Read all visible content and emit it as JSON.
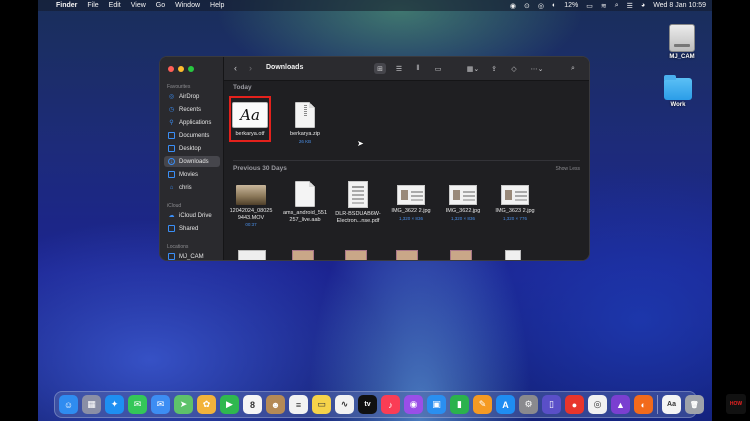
{
  "menubar": {
    "app_name": "Finder",
    "items": [
      "File",
      "Edit",
      "View",
      "Go",
      "Window",
      "Help"
    ],
    "battery": "12%",
    "clock": "Wed 8 Jan  10:59"
  },
  "desktop": {
    "icons": [
      {
        "label": "MJ_CAM",
        "icon": "external-drive-icon"
      },
      {
        "label": "Work",
        "icon": "folder-icon"
      }
    ]
  },
  "finder": {
    "title": "Downloads",
    "sidebar": {
      "favourites_header": "Favourites",
      "favourites": [
        {
          "label": "AirDrop",
          "icon": "airdrop-icon"
        },
        {
          "label": "Recents",
          "icon": "clock-icon"
        },
        {
          "label": "Applications",
          "icon": "applications-icon"
        },
        {
          "label": "Documents",
          "icon": "document-icon"
        },
        {
          "label": "Desktop",
          "icon": "desktop-icon"
        },
        {
          "label": "Downloads",
          "icon": "downloads-icon",
          "active": true
        },
        {
          "label": "Movies",
          "icon": "movies-icon"
        },
        {
          "label": "chris",
          "icon": "home-icon"
        }
      ],
      "icloud_header": "iCloud",
      "icloud": [
        {
          "label": "iCloud Drive",
          "icon": "icloud-icon"
        },
        {
          "label": "Shared",
          "icon": "shared-folder-icon"
        }
      ],
      "locations_header": "Locations",
      "locations": [
        {
          "label": "MJ_CAM",
          "icon": "drive-icon"
        }
      ]
    },
    "today_header": "Today",
    "today_files": [
      {
        "name": "berkarya.otf",
        "meta": "",
        "kind": "font"
      },
      {
        "name": "berkarya.zip",
        "meta": "26 KB",
        "kind": "zip"
      }
    ],
    "previous_header": "Previous 30 Days",
    "show_less": "Show Less",
    "previous_files": [
      {
        "name_line1": "12042024_08025",
        "name_line2": "9443.MOV",
        "meta": "00:37",
        "kind": "video"
      },
      {
        "name_line1": "ams_android_551",
        "name_line2": "257_live.aab",
        "meta": "",
        "kind": "doc"
      },
      {
        "name_line1": "DLR-BSDUAB6W-",
        "name_line2": "Electron...nse.pdf",
        "meta": "",
        "kind": "pdf"
      },
      {
        "name_line1": "IMG_3622 2.jpg",
        "name_line2": "",
        "meta": "1,320 × 836",
        "kind": "image"
      },
      {
        "name_line1": "IMG_3622.jpg",
        "name_line2": "",
        "meta": "1,320 × 836",
        "kind": "image"
      },
      {
        "name_line1": "IMG_3623 2.jpg",
        "name_line2": "",
        "meta": "1,320 × 776",
        "kind": "image"
      }
    ]
  },
  "dock": {
    "apps": [
      {
        "name": "finder-icon",
        "color": "#2f8cf0",
        "glyph": "☺"
      },
      {
        "name": "launchpad-icon",
        "color": "#8a8fa6",
        "glyph": "▦"
      },
      {
        "name": "safari-icon",
        "color": "#1e8ff2",
        "glyph": "✦"
      },
      {
        "name": "messages-icon",
        "color": "#34c759",
        "glyph": "✉"
      },
      {
        "name": "mail-icon",
        "color": "#3d8df3",
        "glyph": "✉"
      },
      {
        "name": "maps-icon",
        "color": "#5ec26a",
        "glyph": "➤"
      },
      {
        "name": "photos-icon",
        "color": "#f2b33c",
        "glyph": "✿"
      },
      {
        "name": "facetime-icon",
        "color": "#2fb84f",
        "glyph": "▶"
      },
      {
        "name": "calendar-icon",
        "color": "#f5f5f5",
        "glyph": "8"
      },
      {
        "name": "contacts-icon",
        "color": "#b58a56",
        "glyph": "☻"
      },
      {
        "name": "reminders-icon",
        "color": "#f2f2f2",
        "glyph": "≡"
      },
      {
        "name": "notes-icon",
        "color": "#f6d34a",
        "glyph": "▭"
      },
      {
        "name": "freeform-icon",
        "color": "#f2f2f2",
        "glyph": "∿"
      },
      {
        "name": "apple-tv-icon",
        "color": "#111111",
        "glyph": "tv"
      },
      {
        "name": "music-icon",
        "color": "#fa3d55",
        "glyph": "♪"
      },
      {
        "name": "podcasts-icon",
        "color": "#9a4ee8",
        "glyph": "◉"
      },
      {
        "name": "keynote-icon",
        "color": "#2a8ff0",
        "glyph": "▣"
      },
      {
        "name": "numbers-icon",
        "color": "#2bb24c",
        "glyph": "▮"
      },
      {
        "name": "pages-icon",
        "color": "#f59a23",
        "glyph": "✎"
      },
      {
        "name": "app-store-icon",
        "color": "#1f8df2",
        "glyph": "A"
      },
      {
        "name": "system-settings-icon",
        "color": "#8a8a8e",
        "glyph": "⚙"
      },
      {
        "name": "iphone-mirroring-icon",
        "color": "#5a4fc8",
        "glyph": "▯"
      },
      {
        "name": "screen-recorder-icon",
        "color": "#e8352c",
        "glyph": "●"
      },
      {
        "name": "chrome-icon",
        "color": "#f1f1f1",
        "glyph": "◎"
      },
      {
        "name": "affinity-icon",
        "color": "#7a3fd0",
        "glyph": "▲"
      },
      {
        "name": "firefox-icon",
        "color": "#f26a1b",
        "glyph": "◐"
      }
    ],
    "trailing": [
      {
        "name": "font-book-icon",
        "color": "#f4f4f4",
        "glyph": "Aa"
      },
      {
        "name": "trash-icon",
        "color": "#9ea2aa",
        "glyph": "🗑"
      }
    ]
  }
}
